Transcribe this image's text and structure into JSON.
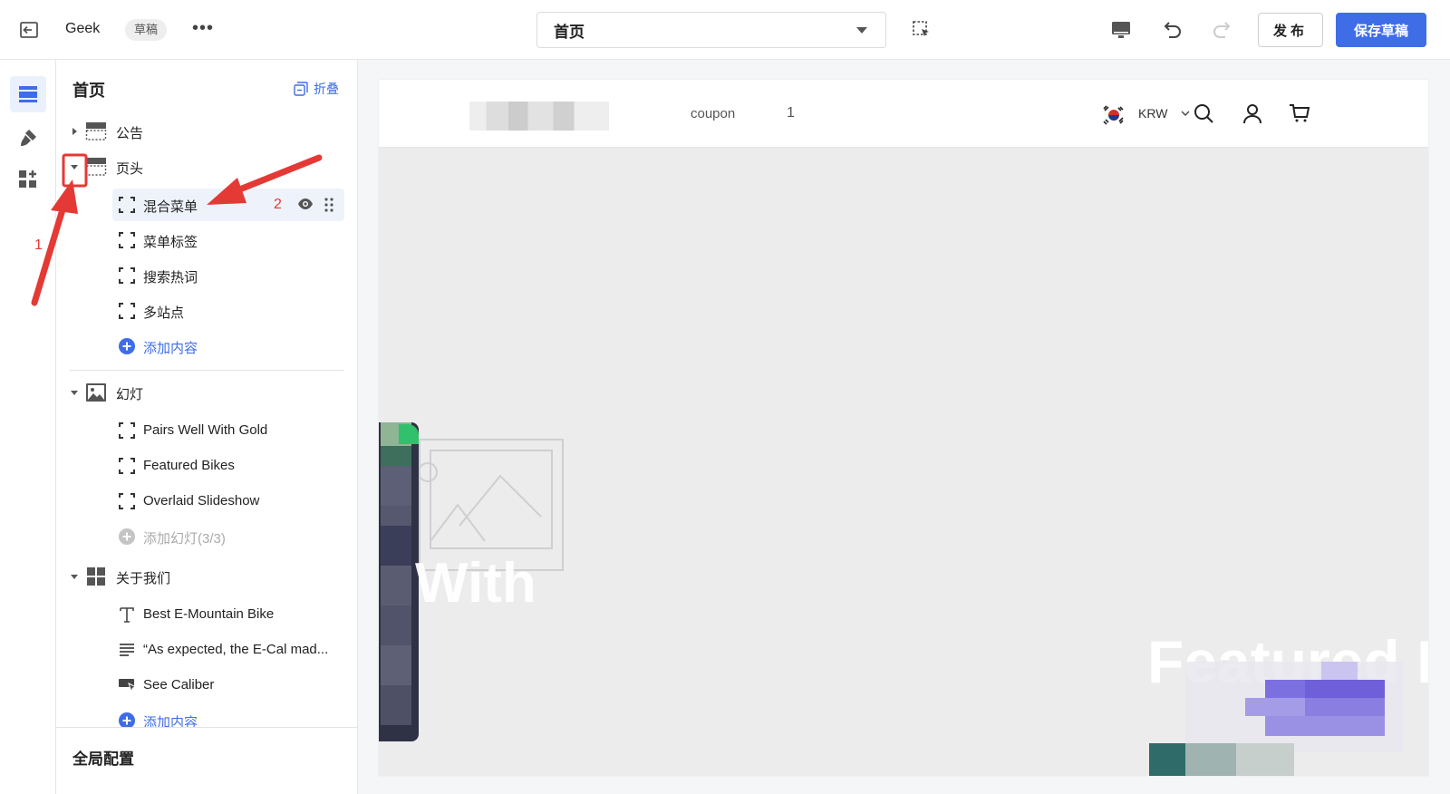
{
  "topbar": {
    "store_name": "Geek",
    "draft_badge": "草稿",
    "more": "•••",
    "page_select_value": "首页",
    "publish_label": "发布",
    "save_label": "保存草稿"
  },
  "panel": {
    "title": "首页",
    "collapse_label": "折叠",
    "sections": [
      {
        "label": "公告",
        "expanded": false
      },
      {
        "label": "页头",
        "expanded": true,
        "children": [
          "混合菜单",
          "菜单标签",
          "搜索热词",
          "多站点"
        ],
        "add_label": "添加内容"
      },
      {
        "label": "幻灯",
        "expanded": true,
        "children": [
          "Pairs Well With Gold",
          "Featured Bikes",
          "Overlaid Slideshow"
        ],
        "add_label": "添加幻灯(3/3)"
      },
      {
        "label": "关于我们",
        "expanded": true,
        "children": [
          "Best E-Mountain Bike",
          "“As expected, the E-Cal mad...",
          "See Caliber"
        ],
        "add_label": "添加内容"
      }
    ],
    "global_config": "全局配置"
  },
  "preview": {
    "nav_coupon": "coupon",
    "nav_one": "1",
    "currency": "KRW",
    "slide_text_1": "With",
    "slide_text_2": "Featured B"
  },
  "annotations": {
    "step_1": "1",
    "step_2": "2"
  },
  "colors": {
    "accent": "#3f6de8",
    "annotation": "#e53935",
    "selected_row_bg": "#eef2fa"
  }
}
